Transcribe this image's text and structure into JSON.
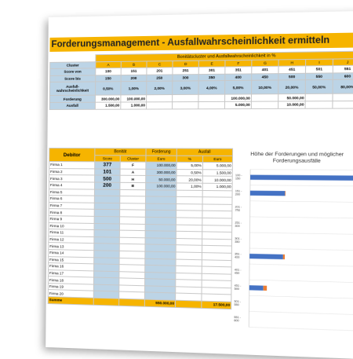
{
  "title": "Forderungsmanagement - Ausfallwahrscheinlichkeit ermitteln",
  "cluster_table": {
    "header": "Bonitätscluster und Ausfallwahrscheinlichkeit in %",
    "row_labels": [
      "Cluster",
      "Score von",
      "Score bis",
      "Ausfall-\nwahrscheinlichkeit",
      "Forderung",
      "Ausfall"
    ],
    "clusters": [
      {
        "name": "A",
        "von": "100",
        "bis": "150",
        "ausfall_pct": "0,50%",
        "forderung": "300.000,00",
        "ausfall": "1.500,00"
      },
      {
        "name": "B",
        "von": "151",
        "bis": "200",
        "ausfall_pct": "1,00%",
        "forderung": "100.000,00",
        "ausfall": "1.000,00"
      },
      {
        "name": "C",
        "von": "201",
        "bis": "250",
        "ausfall_pct": "2,00%",
        "forderung": "",
        "ausfall": ""
      },
      {
        "name": "D",
        "von": "251",
        "bis": "300",
        "ausfall_pct": "3,00%",
        "forderung": "",
        "ausfall": ""
      },
      {
        "name": "E",
        "von": "301",
        "bis": "350",
        "ausfall_pct": "4,00%",
        "forderung": "",
        "ausfall": ""
      },
      {
        "name": "F",
        "von": "351",
        "bis": "400",
        "ausfall_pct": "5,00%",
        "forderung": "100.000,00",
        "ausfall": "5.000,00"
      },
      {
        "name": "G",
        "von": "401",
        "bis": "450",
        "ausfall_pct": "10,00%",
        "forderung": "",
        "ausfall": ""
      },
      {
        "name": "H",
        "von": "451",
        "bis": "500",
        "ausfall_pct": "20,00%",
        "forderung": "50.000,00",
        "ausfall": "10.000,00"
      },
      {
        "name": "I",
        "von": "501",
        "bis": "550",
        "ausfall_pct": "50,00%",
        "forderung": "",
        "ausfall": ""
      },
      {
        "name": "J",
        "von": "551",
        "bis": "600",
        "ausfall_pct": "80,00%",
        "forderung": "",
        "ausfall": ""
      }
    ]
  },
  "debtor_table": {
    "header_debitor": "Debitor",
    "header_bonitaet": "Bonität",
    "header_forderung": "Forderung",
    "header_ausfall": "Ausfall",
    "sub_score": "Score",
    "sub_cluster": "Cluster",
    "sub_euro": "Euro",
    "sub_pct": "%",
    "sub_euro2": "Euro",
    "rows": [
      {
        "name": "Firma 1",
        "score": "377",
        "cluster": "F",
        "forderung": "100.000,00",
        "pct": "5,00%",
        "ausfall": "5.000,00"
      },
      {
        "name": "Firma 2",
        "score": "101",
        "cluster": "A",
        "forderung": "300.000,00",
        "pct": "0,50%",
        "ausfall": "1.500,00"
      },
      {
        "name": "Firma 3",
        "score": "500",
        "cluster": "H",
        "forderung": "50.000,00",
        "pct": "20,00%",
        "ausfall": "10.000,00"
      },
      {
        "name": "Firma 4",
        "score": "200",
        "cluster": "B",
        "forderung": "100.000,00",
        "pct": "1,00%",
        "ausfall": "1.000,00"
      },
      {
        "name": "Firma 5",
        "score": "",
        "cluster": "",
        "forderung": "",
        "pct": "",
        "ausfall": ""
      },
      {
        "name": "Firma 6",
        "score": "",
        "cluster": "",
        "forderung": "",
        "pct": "",
        "ausfall": ""
      },
      {
        "name": "Firma 7",
        "score": "",
        "cluster": "",
        "forderung": "",
        "pct": "",
        "ausfall": ""
      },
      {
        "name": "Firma 8",
        "score": "",
        "cluster": "",
        "forderung": "",
        "pct": "",
        "ausfall": ""
      },
      {
        "name": "Firma 9",
        "score": "",
        "cluster": "",
        "forderung": "",
        "pct": "",
        "ausfall": ""
      },
      {
        "name": "Firma 10",
        "score": "",
        "cluster": "",
        "forderung": "",
        "pct": "",
        "ausfall": ""
      },
      {
        "name": "Firma 11",
        "score": "",
        "cluster": "",
        "forderung": "",
        "pct": "",
        "ausfall": ""
      },
      {
        "name": "Firma 12",
        "score": "",
        "cluster": "",
        "forderung": "",
        "pct": "",
        "ausfall": ""
      },
      {
        "name": "Firma 13",
        "score": "",
        "cluster": "",
        "forderung": "",
        "pct": "",
        "ausfall": ""
      },
      {
        "name": "Firma 14",
        "score": "",
        "cluster": "",
        "forderung": "",
        "pct": "",
        "ausfall": ""
      },
      {
        "name": "Firma 15",
        "score": "",
        "cluster": "",
        "forderung": "",
        "pct": "",
        "ausfall": ""
      },
      {
        "name": "Firma 16",
        "score": "",
        "cluster": "",
        "forderung": "",
        "pct": "",
        "ausfall": ""
      },
      {
        "name": "Firma 17",
        "score": "",
        "cluster": "",
        "forderung": "",
        "pct": "",
        "ausfall": ""
      },
      {
        "name": "Firma 18",
        "score": "",
        "cluster": "",
        "forderung": "",
        "pct": "",
        "ausfall": ""
      },
      {
        "name": "Firma 19",
        "score": "",
        "cluster": "",
        "forderung": "",
        "pct": "",
        "ausfall": ""
      },
      {
        "name": "Firma 20",
        "score": "",
        "cluster": "",
        "forderung": "",
        "pct": "",
        "ausfall": ""
      }
    ],
    "summe_label": "Summe",
    "summe_forderung": "550.000,00",
    "summe_ausfall": "17.500,00"
  },
  "chart_data": {
    "type": "bar",
    "orientation": "horizontal",
    "stacked": true,
    "title": "Höhe der Forderungen und möglicher Forderungsausfälle",
    "categories": [
      "100 - 150",
      "151 - 200",
      "201 - 250",
      "251 - 300",
      "301 - 350",
      "351 - 400",
      "401 - 450",
      "451 - 500",
      "501 - 550",
      "551 - 600"
    ],
    "series": [
      {
        "values": [
          298500,
          99000,
          0,
          0,
          0,
          95000,
          0,
          40000,
          0,
          0
        ],
        "color": "#4472c4"
      },
      {
        "values": [
          1500,
          1000,
          0,
          0,
          0,
          5000,
          0,
          10000,
          0,
          0
        ],
        "color": "#ed7d31"
      }
    ],
    "xlim": [
      0,
      300000
    ],
    "grid": true,
    "legend": "none"
  }
}
